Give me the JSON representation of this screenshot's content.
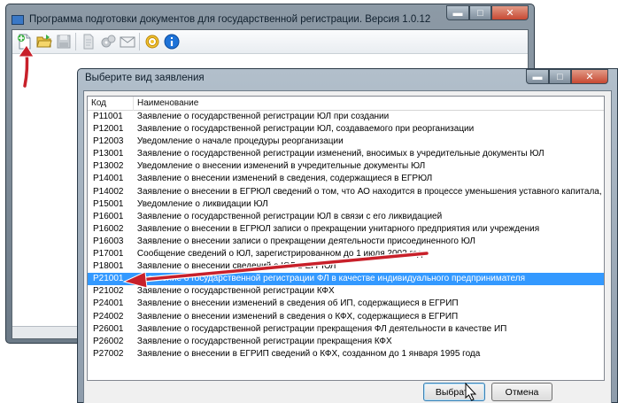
{
  "main_window": {
    "title": "Программа подготовки документов для государственной регистрации. Версия 1.0.12",
    "controls": {
      "minimize_glyph": "▬",
      "maximize_glyph": "□",
      "close_glyph": "✕"
    },
    "toolbar": {
      "buttons": [
        {
          "icon": "new-document-icon",
          "enabled": true
        },
        {
          "icon": "open-folder-icon",
          "enabled": true
        },
        {
          "icon": "save-disk-icon",
          "enabled": false
        },
        {
          "icon": "document-gray-icon",
          "enabled": false
        },
        {
          "icon": "gears-icon",
          "enabled": false
        },
        {
          "icon": "envelope-icon",
          "enabled": false
        },
        {
          "icon": "settings-gear-icon",
          "enabled": true
        },
        {
          "icon": "help-icon",
          "enabled": true
        }
      ]
    }
  },
  "dialog": {
    "title": "Выберите вид заявления",
    "controls": {
      "minimize_glyph": "▬",
      "maximize_glyph": "□",
      "close_glyph": "✕"
    },
    "columns": {
      "code": "Код",
      "name": "Наименование"
    },
    "rows": [
      {
        "code": "P11001",
        "name": "Заявление о государственной регистрации ЮЛ при создании"
      },
      {
        "code": "P12001",
        "name": "Заявление о государственной регистрации ЮЛ, создаваемого при реорганизации"
      },
      {
        "code": "P12003",
        "name": "Уведомление о начале процедуры реорганизации"
      },
      {
        "code": "P13001",
        "name": "Заявление о государственной регистрации изменений, вносимых в учредительные документы ЮЛ"
      },
      {
        "code": "P13002",
        "name": "Уведомление о внесении изменений в учредительные документы ЮЛ"
      },
      {
        "code": "P14001",
        "name": "Заявление о внесении изменений в сведения, содержащиеся в ЕГРЮЛ"
      },
      {
        "code": "P14002",
        "name": "Заявление о внесении в ЕГРЮЛ сведений о том, что АО находится в процессе уменьшения уставного капитала, а так..."
      },
      {
        "code": "P15001",
        "name": "Уведомление о ликвидации ЮЛ"
      },
      {
        "code": "P16001",
        "name": "Заявление о государственной регистрации ЮЛ в связи с его ликвидацией"
      },
      {
        "code": "P16002",
        "name": "Заявление о внесении в ЕГРЮЛ записи о прекращении унитарного предприятия или учреждения"
      },
      {
        "code": "P16003",
        "name": "Заявление о внесении записи о прекращении деятельности присоединенного ЮЛ"
      },
      {
        "code": "P17001",
        "name": "Сообщение сведений о ЮЛ, зарегистрированном до 1 июля 2002 года"
      },
      {
        "code": "P18001",
        "name": "Заявление о внесении сведений о ЮЛ в ЕГРЮЛ"
      },
      {
        "code": "P21001",
        "name": "Заявление о государственной регистрации ФЛ в качестве индивидуального предпринимателя",
        "selected": true
      },
      {
        "code": "P21002",
        "name": "Заявление о государственной регистрации КФХ"
      },
      {
        "code": "P24001",
        "name": "Заявление о внесении изменений в сведения об ИП, содержащиеся в ЕГРИП"
      },
      {
        "code": "P24002",
        "name": "Заявление о внесении изменений в сведения о КФХ, содержащиеся в ЕГРИП"
      },
      {
        "code": "P26001",
        "name": "Заявление о государственной регистрации прекращения ФЛ деятельности в качестве ИП"
      },
      {
        "code": "P26002",
        "name": "Заявление о государственной регистрации прекращения КФХ"
      },
      {
        "code": "P27002",
        "name": "Заявление о внесении в ЕГРИП сведений о КФХ, созданном до 1 января 1995 года"
      }
    ],
    "buttons": {
      "ok": "Выбрать",
      "cancel": "Отмена"
    }
  },
  "colors": {
    "selection": "#3399ff",
    "annotation_arrow": "#c8202a",
    "title_bar": "#8d9aa6"
  }
}
